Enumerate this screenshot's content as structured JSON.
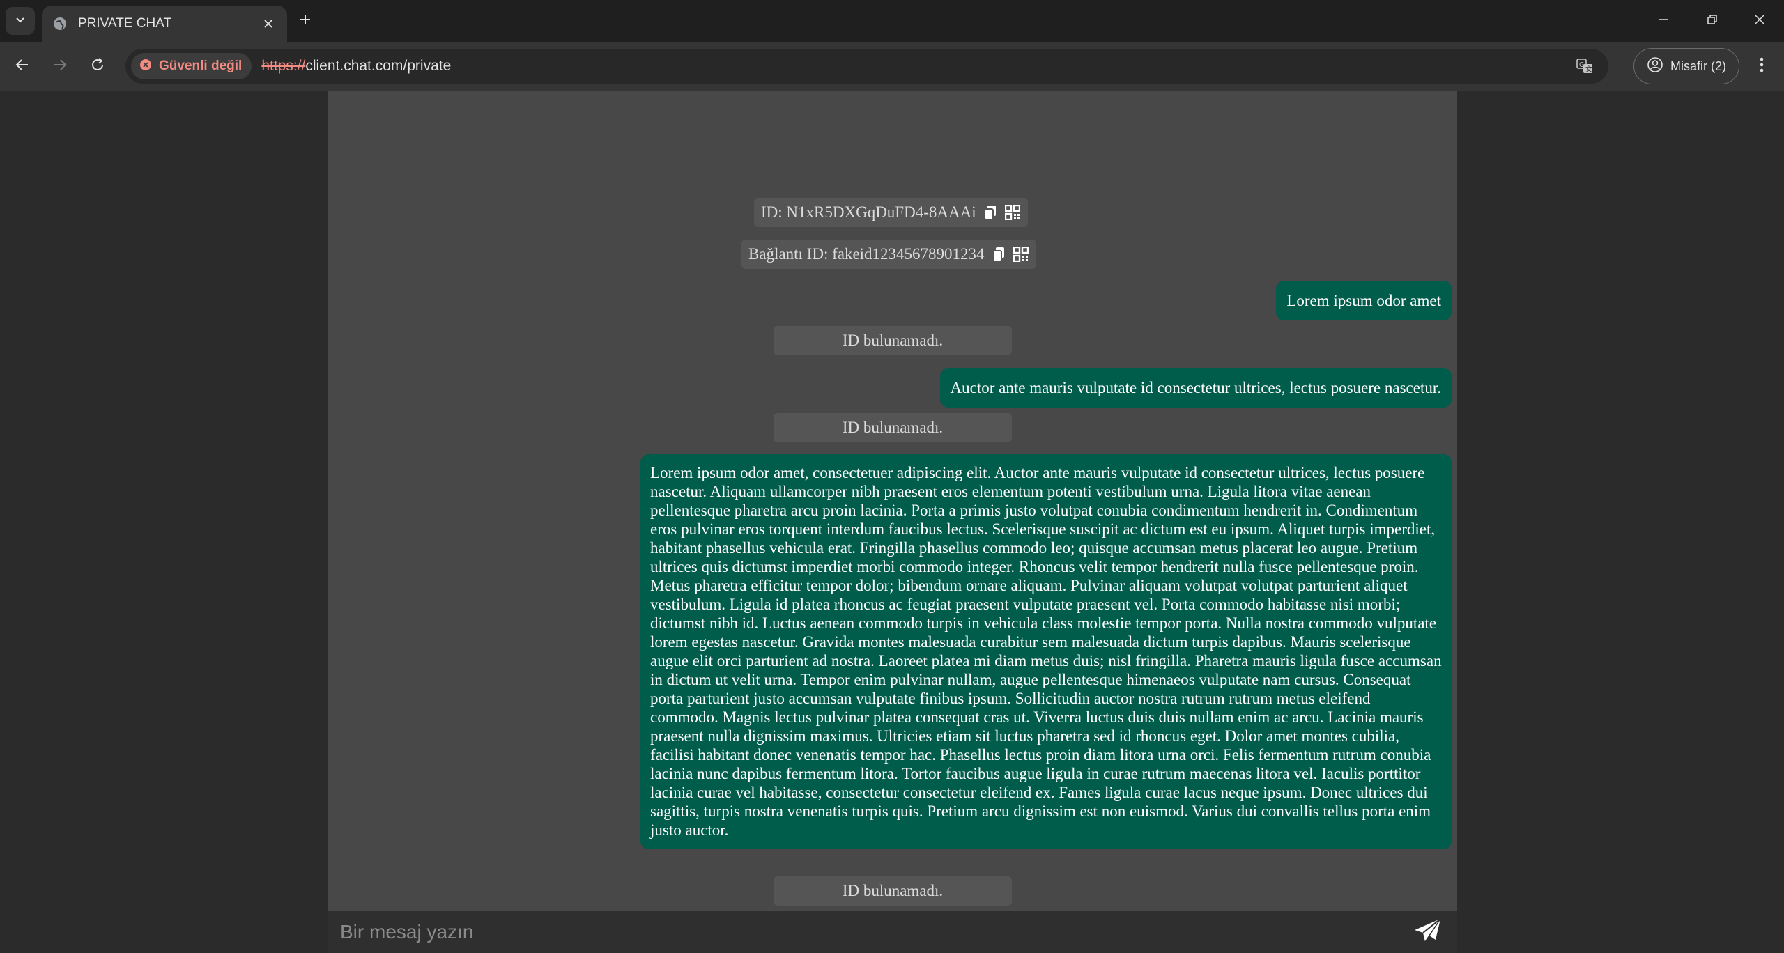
{
  "browser": {
    "tab_title": "PRIVATE CHAT",
    "security_label": "Güvenli değil",
    "url_scheme": "https://",
    "url_rest": "client.chat.com/private",
    "profile_label": "Misafir (2)",
    "icons": {
      "tab_list": "chevron-down-icon",
      "favicon": "globe-icon",
      "tab_close": "close-icon",
      "new_tab": "plus-icon",
      "minimize": "minimize-icon",
      "restore": "restore-icon",
      "close_window": "close-icon",
      "back": "arrow-left-icon",
      "forward": "arrow-right-icon",
      "reload": "reload-icon",
      "security": "warning-circle-icon",
      "translate": "translate-icon",
      "profile": "person-circle-icon",
      "menu": "kebab-menu-icon"
    }
  },
  "chat": {
    "id_label": "ID: N1xR5DXGqDuFD4-8AAAi",
    "connection_id_label": "Bağlantı ID: fakeid12345678901234",
    "messages": [
      {
        "type": "sent",
        "text": "Lorem ipsum odor amet"
      },
      {
        "type": "system",
        "text": "ID bulunamadı."
      },
      {
        "type": "sent",
        "text": "Auctor ante mauris vulputate id consectetur ultrices, lectus posuere nascetur."
      },
      {
        "type": "system",
        "text": "ID bulunamadı."
      },
      {
        "type": "sent",
        "text": "Lorem ipsum odor amet, consectetuer adipiscing elit. Auctor ante mauris vulputate id consectetur ultrices, lectus posuere nascetur. Aliquam ullamcorper nibh praesent eros elementum potenti vestibulum urna. Ligula litora vitae aenean pellentesque pharetra arcu proin lacinia. Porta a primis justo volutpat conubia condimentum hendrerit in. Condimentum eros pulvinar eros torquent interdum faucibus lectus. Scelerisque suscipit ac dictum est eu ipsum. Aliquet turpis imperdiet, habitant phasellus vehicula erat. Fringilla phasellus commodo leo; quisque accumsan metus placerat leo augue. Pretium ultrices quis dictumst imperdiet morbi commodo integer. Rhoncus velit tempor hendrerit nulla fusce pellentesque proin. Metus pharetra efficitur tempor dolor; bibendum ornare aliquam. Pulvinar aliquam volutpat volutpat parturient aliquet vestibulum. Ligula id platea rhoncus ac feugiat praesent vulputate praesent vel. Porta commodo habitasse nisi morbi; dictumst nibh id. Luctus aenean commodo turpis in vehicula class molestie tempor porta. Nulla nostra commodo vulputate lorem egestas nascetur. Gravida montes malesuada curabitur sem malesuada dictum turpis dapibus. Mauris scelerisque augue elit orci parturient ad nostra. Laoreet platea mi diam metus duis; nisl fringilla. Pharetra mauris ligula fusce accumsan in dictum ut velit urna. Tempor enim pulvinar nullam, augue pellentesque himenaeos vulputate nam cursus. Consequat porta parturient justo accumsan vulputate finibus ipsum. Sollicitudin auctor nostra rutrum rutrum metus eleifend commodo. Magnis lectus pulvinar platea consequat cras ut. Viverra luctus duis duis nullam enim ac arcu. Lacinia mauris praesent nulla dignissim maximus. Ultricies etiam sit luctus pharetra sed id rhoncus eget. Dolor amet montes cubilia, facilisi habitant donec venenatis tempor hac. Phasellus lectus proin diam litora urna orci. Felis fermentum rutrum conubia lacinia nunc dapibus fermentum litora. Tortor faucibus augue ligula in curae rutrum maecenas litora vel. Iaculis porttitor lacinia curae vel habitasse, consectetur consectetur eleifend ex. Fames ligula curae lacus neque ipsum. Donec ultrices dui sagittis, turpis nostra venenatis turpis quis. Pretium arcu dignissim est non euismod. Varius dui convallis tellus porta enim justo auctor."
      },
      {
        "type": "system",
        "text": "ID bulunamadı."
      }
    ],
    "composer_placeholder": "Bir mesaj yazın",
    "colors": {
      "sent_bubble": "#005c4b",
      "chat_background": "#484848",
      "page_background": "#2b2b2b",
      "system_chip": "#555555"
    },
    "icons": {
      "copy": "copy-icon",
      "qr": "qr-code-icon",
      "send": "send-icon"
    }
  }
}
